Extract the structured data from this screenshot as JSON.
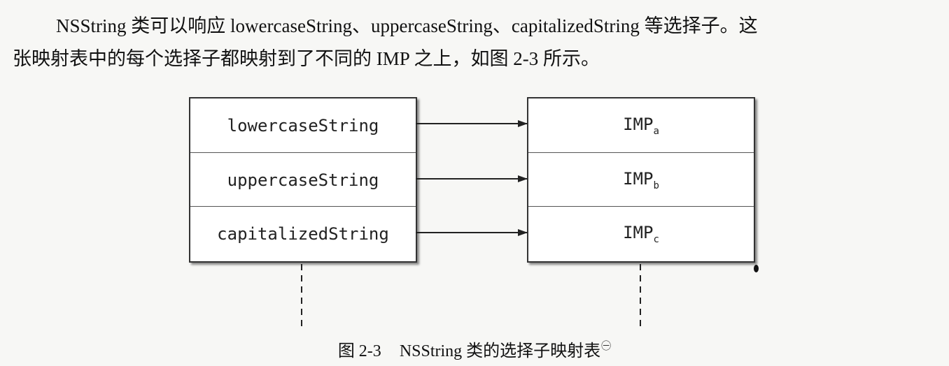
{
  "paragraph": {
    "line1": "NSString 类可以响应 lowercaseString、uppercaseString、capitalizedString 等选择子。这",
    "line2": "张映射表中的每个选择子都映射到了不同的 IMP 之上，如图 2-3 所示。"
  },
  "selectors": [
    "lowercaseString",
    "uppercaseString",
    "capitalizedString"
  ],
  "imps": [
    {
      "base": "IMP",
      "sub": "a"
    },
    {
      "base": "IMP",
      "sub": "b"
    },
    {
      "base": "IMP",
      "sub": "c"
    }
  ],
  "caption": {
    "number": "图 2-3",
    "text": "NSString 类的选择子映射表",
    "footnote_mark": "㊀"
  }
}
